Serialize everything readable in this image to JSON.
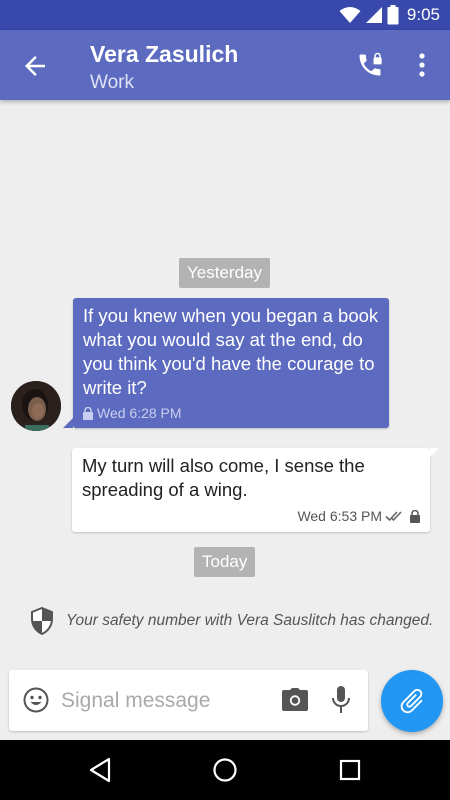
{
  "status_bar": {
    "time": "9:05"
  },
  "toolbar": {
    "contact_name": "Vera Zasulich",
    "contact_subtitle": "Work",
    "back_icon": "arrow-back-icon",
    "call_icon": "secure-call-icon",
    "menu_icon": "more-vert-icon"
  },
  "conversation": {
    "date_yesterday": "Yesterday",
    "date_today": "Today",
    "messages": [
      {
        "direction": "incoming",
        "text": "If you knew when you began a book what you would say at the end, do you think you'd have the courage to write it?",
        "time": "Wed 6:28 PM"
      },
      {
        "direction": "outgoing",
        "text": "My turn will also come, I sense the spreading of a wing.",
        "time": "Wed 6:53 PM"
      }
    ],
    "safety_notice": "Your safety number with Vera Sauslitch has changed."
  },
  "compose": {
    "placeholder": "Signal message"
  },
  "colors": {
    "status_bar": "#3949ab",
    "toolbar": "#5c6bc0",
    "incoming_bubble": "#5c6bc0",
    "outgoing_bubble": "#ffffff",
    "attach_fab": "#2196f3",
    "background": "#eeeeee"
  }
}
